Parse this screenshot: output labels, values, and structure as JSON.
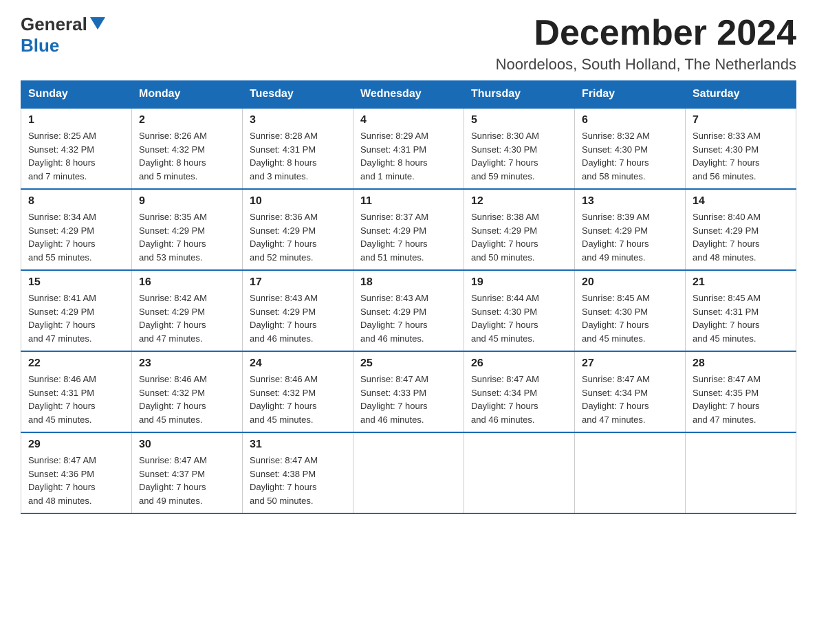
{
  "header": {
    "logo_general": "General",
    "logo_blue": "Blue",
    "month_title": "December 2024",
    "location": "Noordeloos, South Holland, The Netherlands"
  },
  "days_of_week": [
    "Sunday",
    "Monday",
    "Tuesday",
    "Wednesday",
    "Thursday",
    "Friday",
    "Saturday"
  ],
  "weeks": [
    [
      {
        "day": "1",
        "sunrise": "8:25 AM",
        "sunset": "4:32 PM",
        "daylight": "8 hours and 7 minutes."
      },
      {
        "day": "2",
        "sunrise": "8:26 AM",
        "sunset": "4:32 PM",
        "daylight": "8 hours and 5 minutes."
      },
      {
        "day": "3",
        "sunrise": "8:28 AM",
        "sunset": "4:31 PM",
        "daylight": "8 hours and 3 minutes."
      },
      {
        "day": "4",
        "sunrise": "8:29 AM",
        "sunset": "4:31 PM",
        "daylight": "8 hours and 1 minute."
      },
      {
        "day": "5",
        "sunrise": "8:30 AM",
        "sunset": "4:30 PM",
        "daylight": "7 hours and 59 minutes."
      },
      {
        "day": "6",
        "sunrise": "8:32 AM",
        "sunset": "4:30 PM",
        "daylight": "7 hours and 58 minutes."
      },
      {
        "day": "7",
        "sunrise": "8:33 AM",
        "sunset": "4:30 PM",
        "daylight": "7 hours and 56 minutes."
      }
    ],
    [
      {
        "day": "8",
        "sunrise": "8:34 AM",
        "sunset": "4:29 PM",
        "daylight": "7 hours and 55 minutes."
      },
      {
        "day": "9",
        "sunrise": "8:35 AM",
        "sunset": "4:29 PM",
        "daylight": "7 hours and 53 minutes."
      },
      {
        "day": "10",
        "sunrise": "8:36 AM",
        "sunset": "4:29 PM",
        "daylight": "7 hours and 52 minutes."
      },
      {
        "day": "11",
        "sunrise": "8:37 AM",
        "sunset": "4:29 PM",
        "daylight": "7 hours and 51 minutes."
      },
      {
        "day": "12",
        "sunrise": "8:38 AM",
        "sunset": "4:29 PM",
        "daylight": "7 hours and 50 minutes."
      },
      {
        "day": "13",
        "sunrise": "8:39 AM",
        "sunset": "4:29 PM",
        "daylight": "7 hours and 49 minutes."
      },
      {
        "day": "14",
        "sunrise": "8:40 AM",
        "sunset": "4:29 PM",
        "daylight": "7 hours and 48 minutes."
      }
    ],
    [
      {
        "day": "15",
        "sunrise": "8:41 AM",
        "sunset": "4:29 PM",
        "daylight": "7 hours and 47 minutes."
      },
      {
        "day": "16",
        "sunrise": "8:42 AM",
        "sunset": "4:29 PM",
        "daylight": "7 hours and 47 minutes."
      },
      {
        "day": "17",
        "sunrise": "8:43 AM",
        "sunset": "4:29 PM",
        "daylight": "7 hours and 46 minutes."
      },
      {
        "day": "18",
        "sunrise": "8:43 AM",
        "sunset": "4:29 PM",
        "daylight": "7 hours and 46 minutes."
      },
      {
        "day": "19",
        "sunrise": "8:44 AM",
        "sunset": "4:30 PM",
        "daylight": "7 hours and 45 minutes."
      },
      {
        "day": "20",
        "sunrise": "8:45 AM",
        "sunset": "4:30 PM",
        "daylight": "7 hours and 45 minutes."
      },
      {
        "day": "21",
        "sunrise": "8:45 AM",
        "sunset": "4:31 PM",
        "daylight": "7 hours and 45 minutes."
      }
    ],
    [
      {
        "day": "22",
        "sunrise": "8:46 AM",
        "sunset": "4:31 PM",
        "daylight": "7 hours and 45 minutes."
      },
      {
        "day": "23",
        "sunrise": "8:46 AM",
        "sunset": "4:32 PM",
        "daylight": "7 hours and 45 minutes."
      },
      {
        "day": "24",
        "sunrise": "8:46 AM",
        "sunset": "4:32 PM",
        "daylight": "7 hours and 45 minutes."
      },
      {
        "day": "25",
        "sunrise": "8:47 AM",
        "sunset": "4:33 PM",
        "daylight": "7 hours and 46 minutes."
      },
      {
        "day": "26",
        "sunrise": "8:47 AM",
        "sunset": "4:34 PM",
        "daylight": "7 hours and 46 minutes."
      },
      {
        "day": "27",
        "sunrise": "8:47 AM",
        "sunset": "4:34 PM",
        "daylight": "7 hours and 47 minutes."
      },
      {
        "day": "28",
        "sunrise": "8:47 AM",
        "sunset": "4:35 PM",
        "daylight": "7 hours and 47 minutes."
      }
    ],
    [
      {
        "day": "29",
        "sunrise": "8:47 AM",
        "sunset": "4:36 PM",
        "daylight": "7 hours and 48 minutes."
      },
      {
        "day": "30",
        "sunrise": "8:47 AM",
        "sunset": "4:37 PM",
        "daylight": "7 hours and 49 minutes."
      },
      {
        "day": "31",
        "sunrise": "8:47 AM",
        "sunset": "4:38 PM",
        "daylight": "7 hours and 50 minutes."
      },
      null,
      null,
      null,
      null
    ]
  ]
}
